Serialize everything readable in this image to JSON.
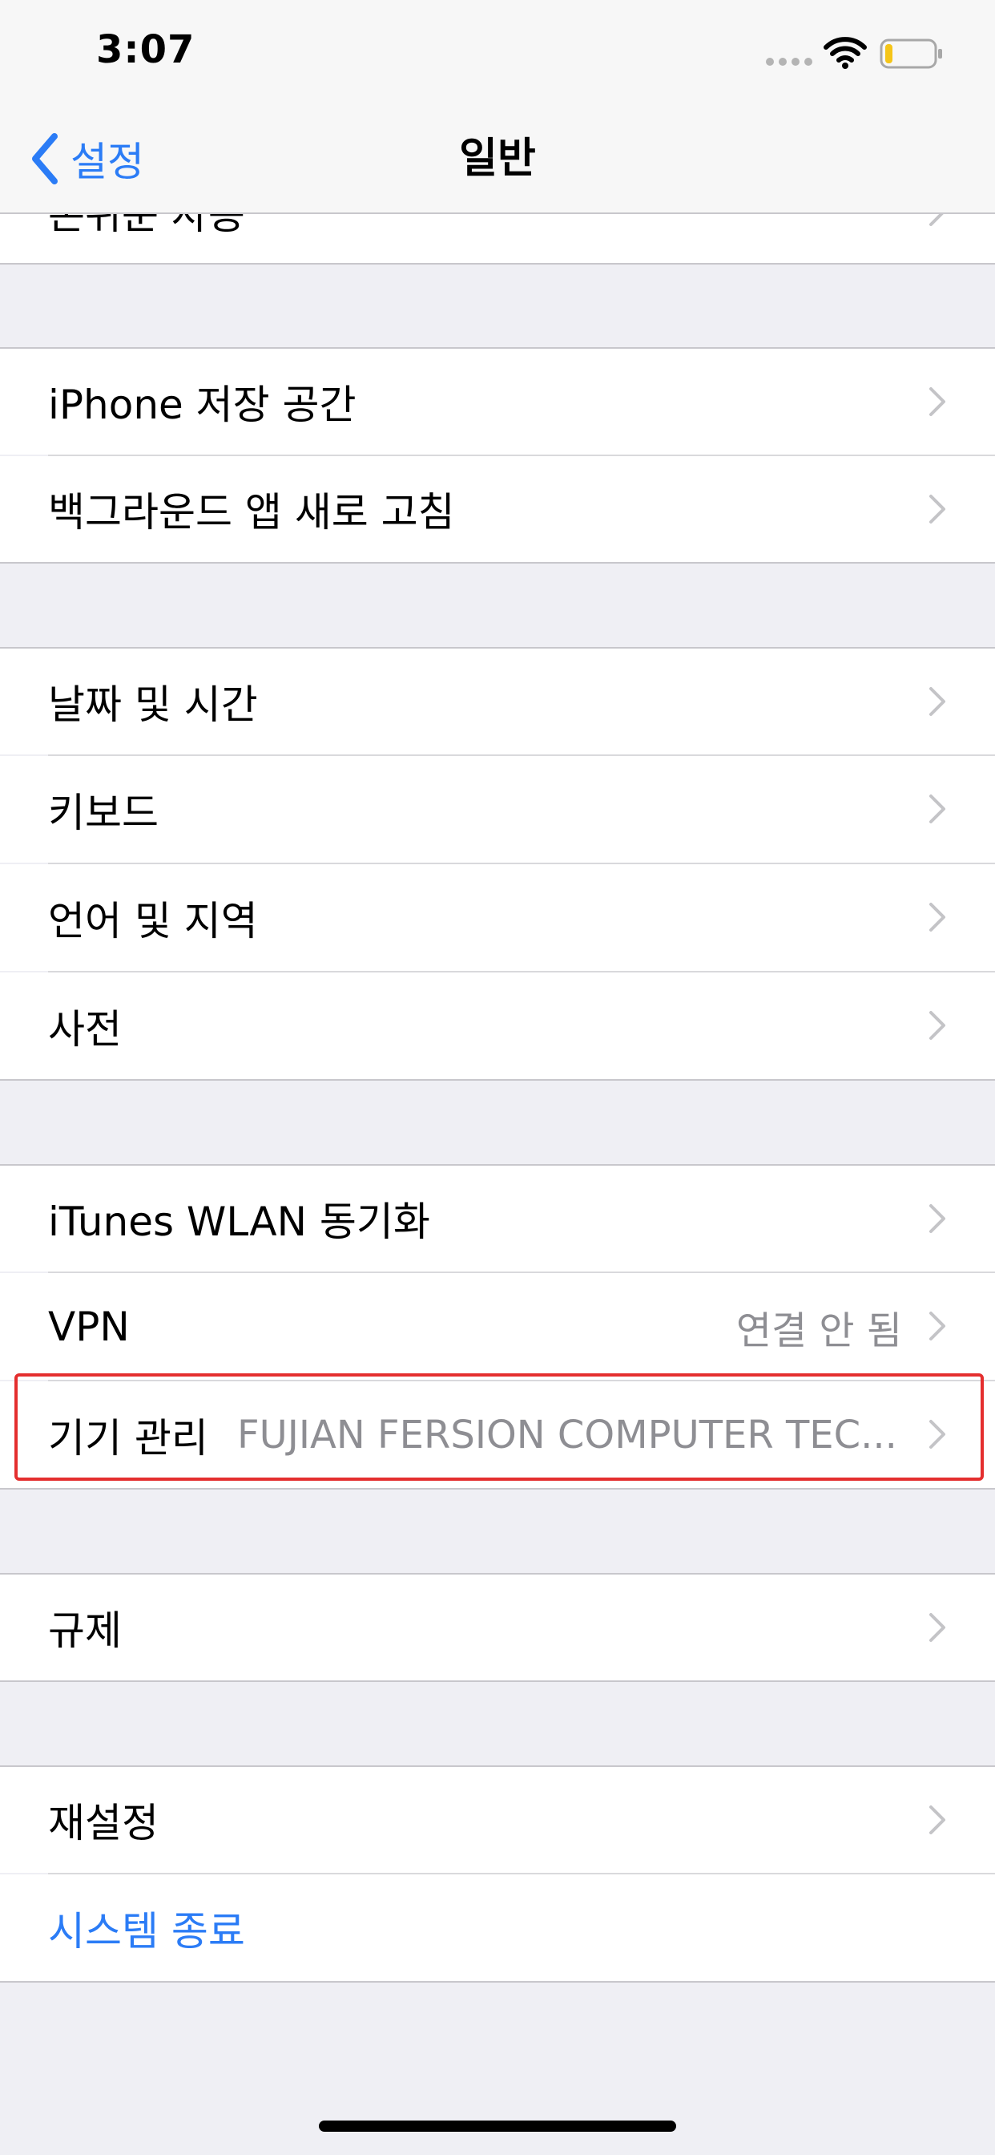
{
  "status_bar": {
    "time": "3:07"
  },
  "nav": {
    "back_label": "설정",
    "title": "일반"
  },
  "sections": [
    {
      "items": [
        {
          "label": "손쉬운 사용"
        }
      ]
    },
    {
      "items": [
        {
          "label": "iPhone 저장 공간"
        },
        {
          "label": "백그라운드 앱 새로 고침"
        }
      ]
    },
    {
      "items": [
        {
          "label": "날짜 및 시간"
        },
        {
          "label": "키보드"
        },
        {
          "label": "언어 및 지역"
        },
        {
          "label": "사전"
        }
      ]
    },
    {
      "items": [
        {
          "label": "iTunes WLAN 동기화"
        },
        {
          "label": "VPN",
          "detail": "연결 안 됨"
        },
        {
          "label": "기기 관리",
          "detail": "FUJIAN FERSION COMPUTER TEC...",
          "highlighted": true
        }
      ]
    },
    {
      "items": [
        {
          "label": "규제"
        }
      ]
    },
    {
      "items": [
        {
          "label": "재설정"
        },
        {
          "label": "시스템 종료",
          "style": "action-blue"
        }
      ]
    }
  ],
  "colors": {
    "accent": "#2b7cf6",
    "highlight_border": "#e42e2e",
    "background": "#efeff4",
    "battery_level": "#f5c518"
  },
  "battery_level_fraction": 0.15
}
